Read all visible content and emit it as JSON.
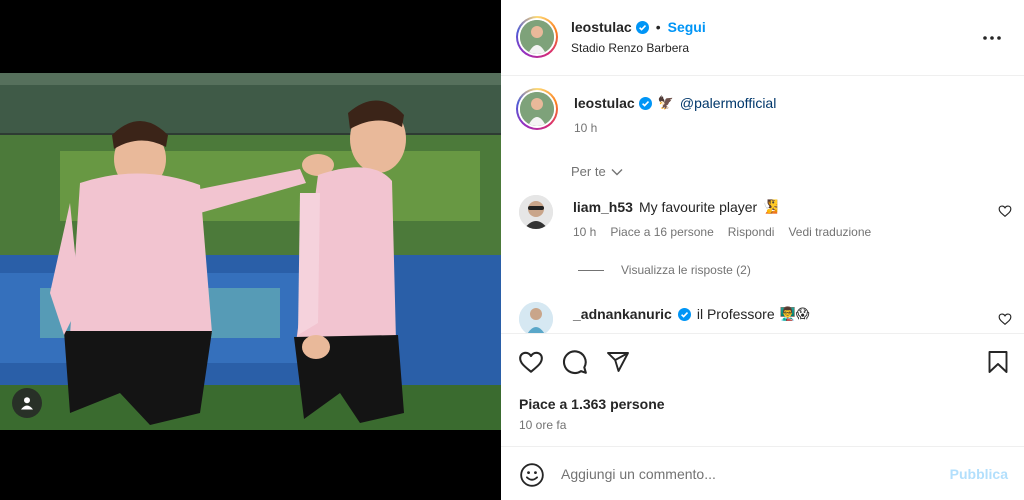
{
  "post": {
    "author": "leostulac",
    "follow_label": "Segui",
    "separator": "•",
    "location": "Stadio Renzo Barbera",
    "more_icon": "more-horizontal-icon"
  },
  "caption": {
    "username": "leostulac",
    "emoji": "🦅",
    "mention": "@palermofficial",
    "time": "10 h"
  },
  "sort": {
    "label": "Per te"
  },
  "comments": [
    {
      "username": "liam_h53",
      "text": "My favourite player",
      "emoji": "🧏",
      "time": "10 h",
      "likes": "Piace a 16 persone",
      "reply": "Rispondi",
      "translate": "Vedi traduzione"
    },
    {
      "username": "_adnankanuric",
      "text": "il Professore",
      "emoji": "👨‍🏫😱"
    }
  ],
  "replies_label": "Visualizza le risposte (2)",
  "actions": {
    "likes": "Piace a 1.363 persone",
    "time_ago": "10 ore fa"
  },
  "add_comment": {
    "placeholder": "Aggiungi un commento...",
    "publish": "Pubblica"
  },
  "colors": {
    "accent": "#0095f6",
    "verified": "#0095f6",
    "publish_disabled": "#b2dffc",
    "jersey_pink": "#f2c4d0"
  }
}
